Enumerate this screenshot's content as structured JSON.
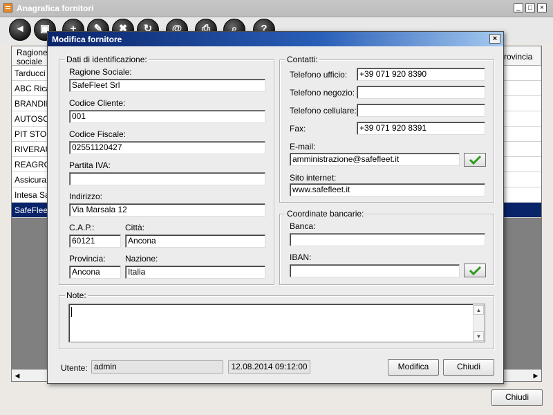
{
  "main": {
    "title": "Anagrafica fornitori",
    "window_buttons": {
      "minimize": "_",
      "maximize": "□",
      "close": "×"
    },
    "toolbar": [
      {
        "name": "back-icon",
        "glyph": "◄"
      },
      {
        "name": "new-document-icon",
        "glyph": "▣"
      },
      {
        "name": "add-icon",
        "glyph": "+"
      },
      {
        "name": "edit-icon",
        "glyph": "✎"
      },
      {
        "name": "delete-icon",
        "glyph": "✖"
      },
      {
        "name": "refresh-icon",
        "glyph": "↻"
      },
      {
        "name": "email-icon",
        "glyph": "@"
      },
      {
        "name": "print-icon",
        "glyph": "⎙"
      },
      {
        "name": "search-icon",
        "glyph": "⌕"
      },
      {
        "name": "help-icon",
        "glyph": "?"
      }
    ],
    "grid": {
      "col_ragione": "Ragione sociale",
      "col_provincia": "rovincia",
      "rows": [
        "Tarducci S",
        "ABC Ricar",
        "BRANDIN",
        "AUTOSCA",
        "PIT STOP",
        "RIVERAU",
        "REAGRO",
        "Assicurazi",
        "Intesa Sar",
        "SafeFleet"
      ],
      "selected_row": "SafeFleet"
    },
    "close_label": "Chiudi"
  },
  "dialog": {
    "title": "Modifica fornitore",
    "close_glyph": "×",
    "identificazione": {
      "legend": "Dati di identificazione:",
      "ragione_sociale_label": "Ragione Sociale:",
      "ragione_sociale": "SafeFleet Srl",
      "codice_cliente_label": "Codice Cliente:",
      "codice_cliente": "001",
      "codice_fiscale_label": "Codice Fiscale:",
      "codice_fiscale": "02551120427",
      "partita_iva_label": "Partita IVA:",
      "partita_iva": "",
      "indirizzo_label": "Indirizzo:",
      "indirizzo": "Via Marsala 12",
      "cap_label": "C.A.P.:",
      "cap": "60121",
      "citta_label": "Città:",
      "citta": "Ancona",
      "provincia_label": "Provincia:",
      "provincia": "Ancona",
      "nazione_label": "Nazione:",
      "nazione": "Italia"
    },
    "contatti": {
      "legend": "Contatti:",
      "tel_ufficio_label": "Telefono ufficio:",
      "tel_ufficio": "+39 071 920 8390",
      "tel_negozio_label": "Telefono negozio:",
      "tel_negozio": "",
      "tel_cellulare_label": "Telefono cellulare:",
      "tel_cellulare": "",
      "fax_label": "Fax:",
      "fax": "+39 071 920 8391",
      "email_label": "E-mail:",
      "email": "amministrazione@safefleet.it",
      "sito_label": "Sito internet:",
      "sito": "www.safefleet.it"
    },
    "banca": {
      "legend": "Coordinate bancarie:",
      "banca_label": "Banca:",
      "banca": "",
      "iban_label": "IBAN:",
      "iban": ""
    },
    "note": {
      "legend": "Note:",
      "value": ""
    },
    "footer": {
      "utente_label": "Utente:",
      "utente": "admin",
      "timestamp": "12.08.2014 09:12:00",
      "modifica_label": "Modifica",
      "chiudi_label": "Chiudi"
    },
    "colors": {
      "titlebar_start": "#0a246a",
      "titlebar_end": "#a6caf0",
      "check_green": "#2e9a1e",
      "selection": "#0a246a"
    }
  }
}
